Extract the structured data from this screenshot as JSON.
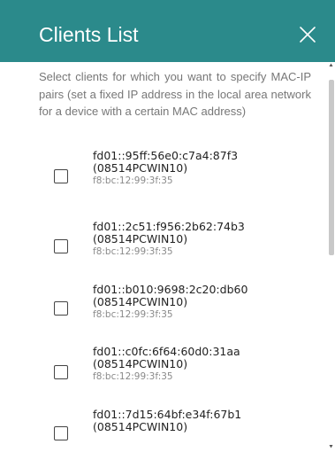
{
  "dialog": {
    "title": "Clients List",
    "close_icon": "close-icon"
  },
  "description": "Select clients for which you want to specify MAC-IP pairs (set a fixed IP address in the local area network for a device with a certain MAC address)",
  "clients": [
    {
      "ip": "fd01::95ff:56e0:c7a4:87f3",
      "host": "(08514PCWIN10)",
      "mac": "f8:bc:12:99:3f:35",
      "checked": false
    },
    {
      "ip": "fd01::2c51:f956:2b62:74b3",
      "host": "(08514PCWIN10)",
      "mac": "f8:bc:12:99:3f:35",
      "checked": false
    },
    {
      "ip": "fd01::b010:9698:2c20:db60",
      "host": "(08514PCWIN10)",
      "mac": "f8:bc:12:99:3f:35",
      "checked": false
    },
    {
      "ip": "fd01::c0fc:6f64:60d0:31aa",
      "host": "(08514PCWIN10)",
      "mac": "f8:bc:12:99:3f:35",
      "checked": false
    },
    {
      "ip": "fd01::7d15:64bf:e34f:67b1",
      "host": "(08514PCWIN10)",
      "checked": false
    }
  ],
  "colors": {
    "header_background": "#2b8a8b",
    "header_text": "#ffffff",
    "description_text": "#777777",
    "client_text": "#222222",
    "mac_text": "#8a8a8a"
  }
}
